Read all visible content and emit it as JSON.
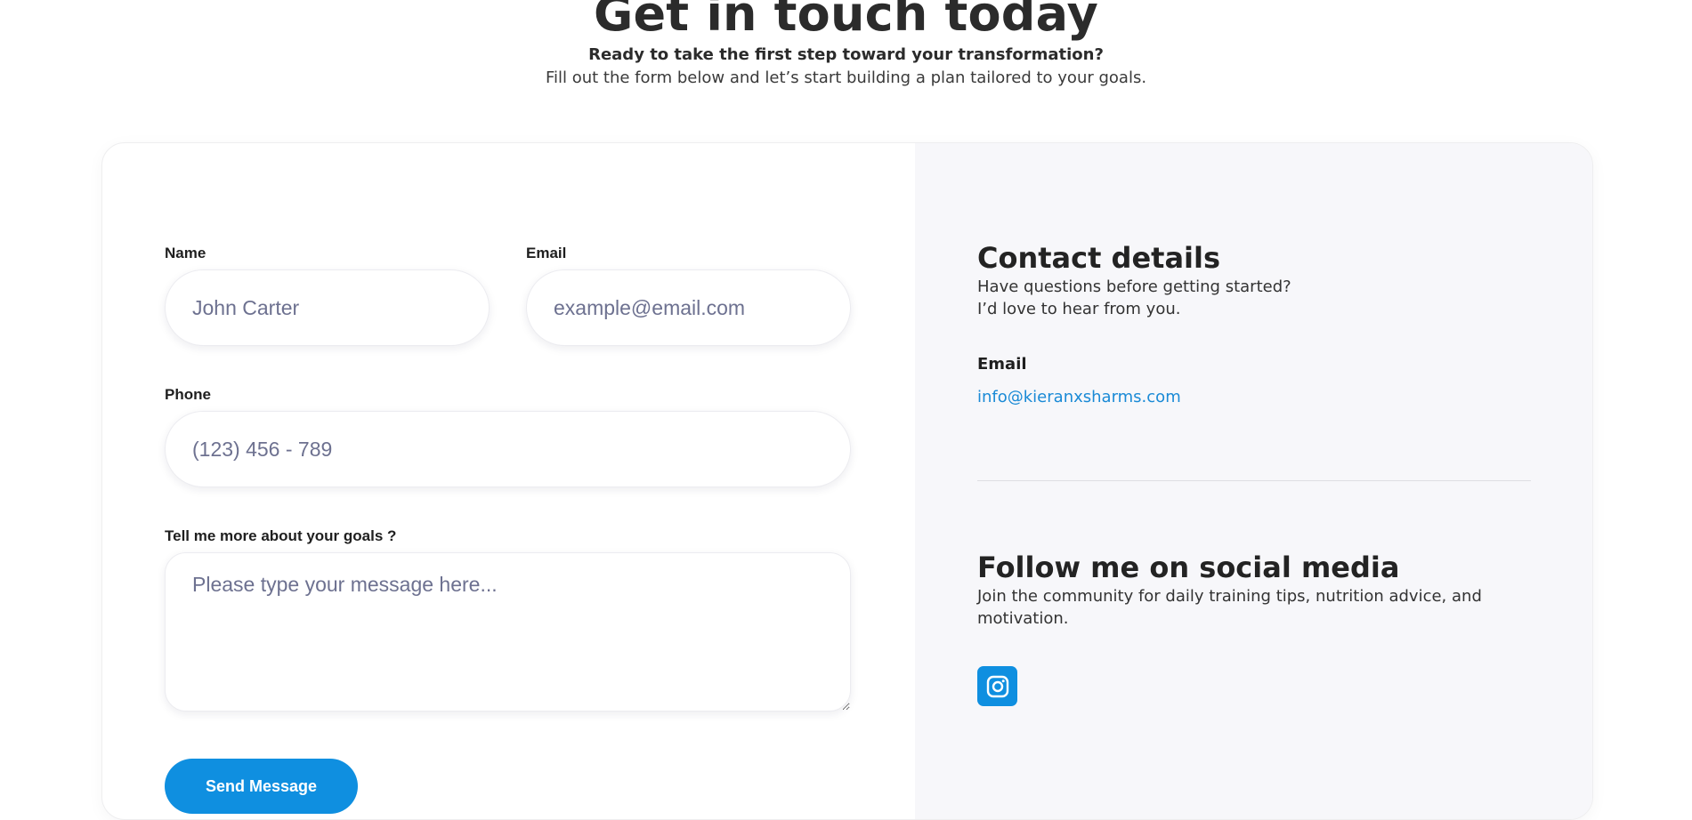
{
  "header": {
    "title": "Get in touch today",
    "lead": "Ready to take the first step toward your transformation?",
    "sublead": "Fill out the form below and let’s start building a plan tailored to your goals."
  },
  "form": {
    "name_label": "Name",
    "name_placeholder": "John Carter",
    "email_label": "Email",
    "email_placeholder": "example@email.com",
    "phone_label": "Phone",
    "phone_placeholder": "(123) 456 - 789",
    "message_label": "Tell me more about your goals ?",
    "message_placeholder": "Please type your message here...",
    "submit_label": "Send Message"
  },
  "contact": {
    "title": "Contact details",
    "text_line1": "Have questions before getting started?",
    "text_line2": "I’d love to hear from you.",
    "email_label": "Email",
    "email_value": "info@kieranxsharms.com"
  },
  "social": {
    "title": "Follow me on social media",
    "text": "Join the community for daily training tips, nutrition advice, and motivation.",
    "icons": [
      "instagram-icon"
    ]
  },
  "colors": {
    "accent": "#0f8fe0",
    "link": "#1a8ad6",
    "panel_bg": "#f7f7fa"
  }
}
